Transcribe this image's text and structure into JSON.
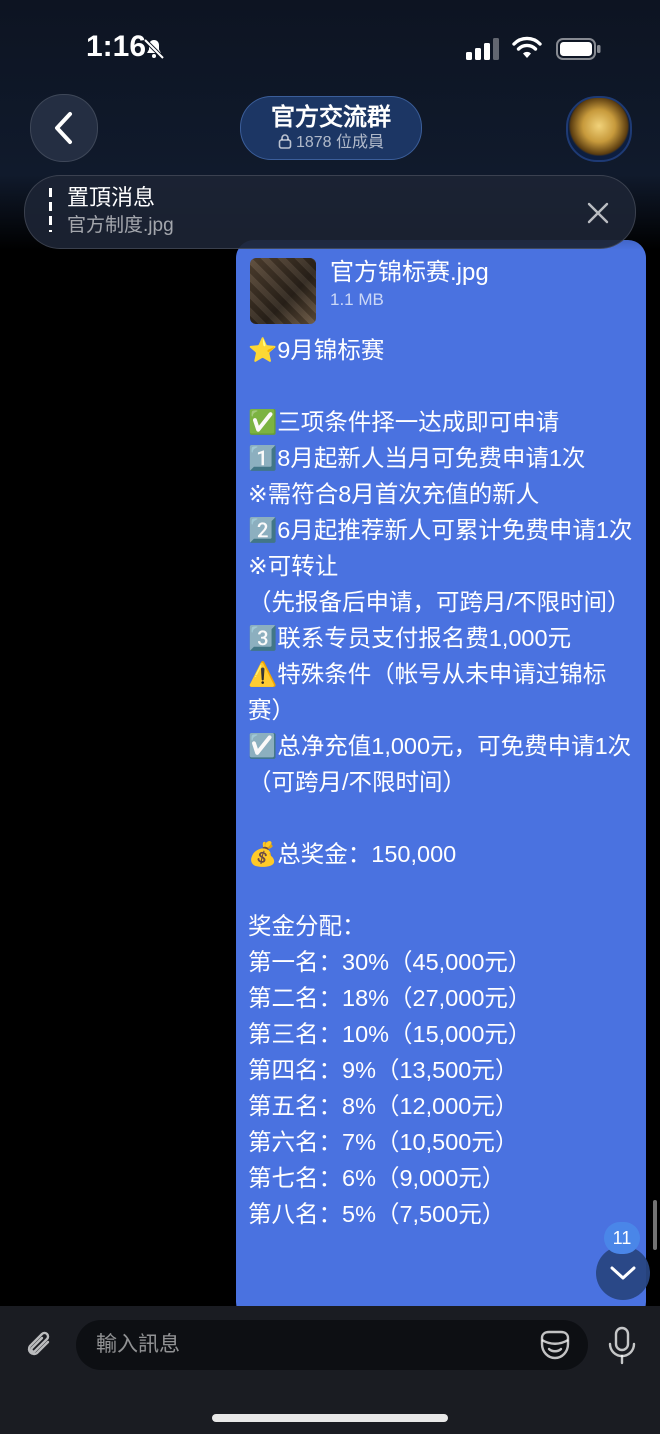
{
  "status_bar": {
    "time": "1:16"
  },
  "header": {
    "title": "官方交流群",
    "member_count": "1878 位成員"
  },
  "pinned": {
    "title": "置頂消息",
    "subtitle": "官方制度.jpg"
  },
  "message": {
    "file_name": "官方锦标赛.jpg",
    "file_size": "1.1 MB",
    "lines": [
      "⭐9月锦标赛",
      "",
      "✅三项条件择一达成即可申请",
      "1️⃣8月起新人当月可免费申请1次",
      "※需符合8月首次充值的新人",
      "2️⃣6月起推荐新人可累计免费申请1次",
      "※可转让",
      "（先报备后申请，可跨月/不限时间）",
      "3️⃣联系专员支付报名费1,000元",
      "⚠️特殊条件（帐号从未申请过锦标赛）",
      "☑️总净充值1,000元，可免费申请1次（可跨月/不限时间）",
      "",
      "💰总奖金：150,000",
      "",
      "奖金分配：",
      "第一名：30%（45,000元）",
      "第二名：18%（27,000元）",
      "第三名：10%（15,000元）",
      "第四名：9%（13,500元）",
      "第五名：8%（12,000元）",
      "第六名：7%（10,500元）",
      "第七名：6%（9,000元）",
      "第八名：5%（7,500元）"
    ]
  },
  "unread_count": "11",
  "composer": {
    "placeholder": "輸入訊息"
  },
  "colors": {
    "bubble": "#4a72e0",
    "accent": "#4a86e8",
    "background": "#000000"
  },
  "icons": [
    "bell-off-icon",
    "signal-icon",
    "wifi-icon",
    "battery-icon",
    "back-arrow-icon",
    "lock-icon",
    "close-icon",
    "chevron-down-icon",
    "paperclip-icon",
    "sticker-icon",
    "microphone-icon"
  ]
}
